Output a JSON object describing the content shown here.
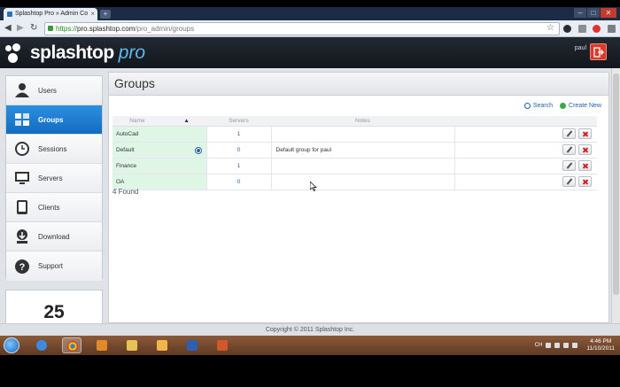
{
  "browser": {
    "tab_title": "Splashtop Pro » Admin Co",
    "tab_close": "×",
    "new_tab": "+",
    "url_scheme": "https://",
    "url_host": "pro.splashtop.com",
    "url_path": "/pro_admin/groups",
    "controls": [
      "–",
      "□",
      "✕"
    ]
  },
  "app": {
    "brand": "splashtop",
    "brand_suffix": "pro",
    "user": "paul"
  },
  "sidebar": {
    "items": [
      {
        "label": "Users",
        "icon": "user-icon"
      },
      {
        "label": "Groups",
        "icon": "groups-icon",
        "active": true
      },
      {
        "label": "Sessions",
        "icon": "clock-icon"
      },
      {
        "label": "Servers",
        "icon": "monitor-icon"
      },
      {
        "label": "Clients",
        "icon": "tablet-icon"
      },
      {
        "label": "Download",
        "icon": "download-icon"
      },
      {
        "label": "Support",
        "icon": "help-icon"
      }
    ],
    "counter": "25"
  },
  "panel": {
    "title": "Groups",
    "search_label": "Search",
    "create_label": "Create New",
    "columns": [
      "Name",
      "Servers",
      "Notes"
    ],
    "rows": [
      {
        "name": "AutoCad",
        "servers": "1",
        "notes": "",
        "default": false
      },
      {
        "name": "Default",
        "servers": "0",
        "notes": "Default group for paul",
        "default": true
      },
      {
        "name": "Finance",
        "servers": "1",
        "notes": "",
        "default": false
      },
      {
        "name": "OA",
        "servers": "0",
        "notes": "",
        "default": false
      }
    ],
    "found": "4 Found"
  },
  "footer": {
    "copyright": "Copyright © 2011 Splashtop Inc."
  },
  "taskbar": {
    "lang": "CH",
    "time": "4:46 PM",
    "date": "11/10/2011"
  },
  "colors": {
    "accent": "#136bc0",
    "header": "#12161c",
    "name_cell": "#dff5e5",
    "delete": "#d51b1b"
  }
}
